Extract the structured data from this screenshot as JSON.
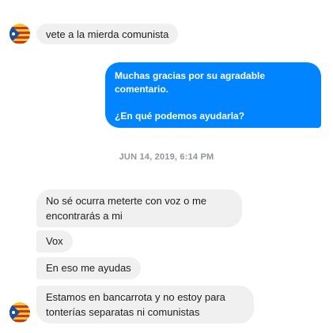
{
  "conversation": {
    "first_message": {
      "text": "vete a la mierda comunista"
    },
    "bot_reply": {
      "line1": "Muchas gracias por su agradable comentario.",
      "line2": "¿En qué podemos ayudarla?"
    },
    "timestamp": "JUN 14, 2019, 6:14 PM",
    "messages": [
      {
        "text": "No sé ocurra meterte con voz o me encontrarás a mi"
      },
      {
        "text": "Vox"
      },
      {
        "text": "En eso me ayudas"
      },
      {
        "text": "Estamos en bancarrota y no estoy para tonterías separatas ni comunistas"
      }
    ]
  },
  "colors": {
    "outgoing_bubble": "#0084ff",
    "incoming_bubble": "#f1f0f0",
    "timestamp": "#90949c"
  }
}
